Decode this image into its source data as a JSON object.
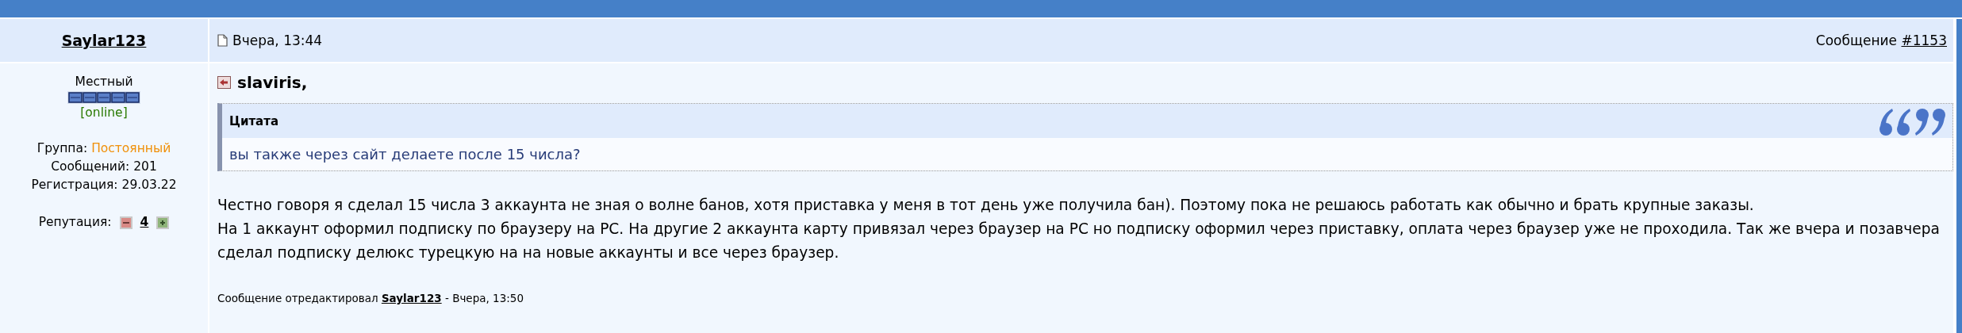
{
  "author": {
    "name": "Saylar123",
    "rank": "Местный",
    "status": "[online]",
    "group_label": "Группа:",
    "group": "Постоянный",
    "posts": "Сообщений: 201",
    "registered": "Регистрация: 29.03.22",
    "reputation_label": "Репутация:",
    "reputation": "4"
  },
  "post": {
    "date": "Вчера, 13:44",
    "number_label": "Сообщение",
    "number": "#1153",
    "reply_to": "slaviris,",
    "quote": {
      "title": "Цитата",
      "text": "вы также через сайт делаете после 15 числа?"
    },
    "paragraphs": [
      "Честно говоря я сделал 15 числа 3 аккаунта не зная о волне банов, хотя приставка у меня в тот день уже получила бан). Поэтому пока не решаюсь работать как обычно и брать крупные заказы.",
      "На 1 аккаунт оформил подписку по браузеру на PC. На другие 2 аккаунта карту привязал через браузер на PC но подписку оформил через приставку, оплата через браузер уже не проходила. Так же вчера и позавчера сделал подписку делюкс турецкую на на новые аккаунты и все через браузер."
    ],
    "edit_note": {
      "text": "Сообщение отредактировал",
      "editor": "Saylar123",
      "time": "- Вчера, 13:50"
    }
  }
}
